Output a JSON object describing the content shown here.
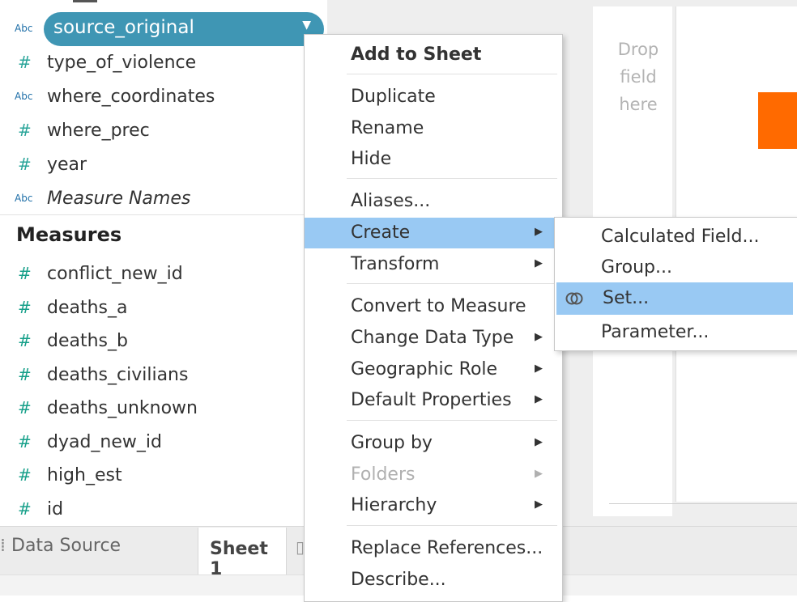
{
  "data_pane": {
    "selected_field": "source_original",
    "dimensions": [
      {
        "type": "hash",
        "name": "type_of_violence"
      },
      {
        "type": "abc",
        "name": "where_coordinates"
      },
      {
        "type": "hash",
        "name": "where_prec"
      },
      {
        "type": "hash",
        "name": "year"
      },
      {
        "type": "abc",
        "name": "Measure Names"
      }
    ],
    "measures_header": "Measures",
    "measures": [
      {
        "type": "hash",
        "name": "conflict_new_id"
      },
      {
        "type": "hash",
        "name": "deaths_a"
      },
      {
        "type": "hash",
        "name": "deaths_b"
      },
      {
        "type": "hash",
        "name": "deaths_civilians"
      },
      {
        "type": "hash",
        "name": "deaths_unknown"
      },
      {
        "type": "hash",
        "name": "dyad_new_id"
      },
      {
        "type": "hash",
        "name": "high_est"
      },
      {
        "type": "hash",
        "name": "id"
      }
    ],
    "type_glyphs": {
      "abc": "Abc",
      "hash": "#"
    }
  },
  "shelf": {
    "drop_lines": [
      "Drop",
      "field",
      "here"
    ]
  },
  "tabs": {
    "data_source": "Data Source",
    "sheet1": "Sheet 1"
  },
  "context_menu": {
    "items": [
      {
        "label": "Add to Sheet"
      },
      {
        "label": "Duplicate"
      },
      {
        "label": "Rename"
      },
      {
        "label": "Hide"
      },
      {
        "label": "Aliases..."
      },
      {
        "label": "Create"
      },
      {
        "label": "Transform"
      },
      {
        "label": "Convert to Measure"
      },
      {
        "label": "Change Data Type"
      },
      {
        "label": "Geographic Role"
      },
      {
        "label": "Default Properties"
      },
      {
        "label": "Group by"
      },
      {
        "label": "Folders"
      },
      {
        "label": "Hierarchy"
      },
      {
        "label": "Replace References..."
      },
      {
        "label": "Describe..."
      }
    ]
  },
  "submenu": {
    "items": [
      {
        "label": "Calculated Field..."
      },
      {
        "label": "Group..."
      },
      {
        "label": "Set..."
      },
      {
        "label": "Parameter..."
      }
    ]
  },
  "colors": {
    "accent_pill": "#3f96b4",
    "menu_highlight": "#99c9f3",
    "mark_orange": "#ff6a00"
  }
}
